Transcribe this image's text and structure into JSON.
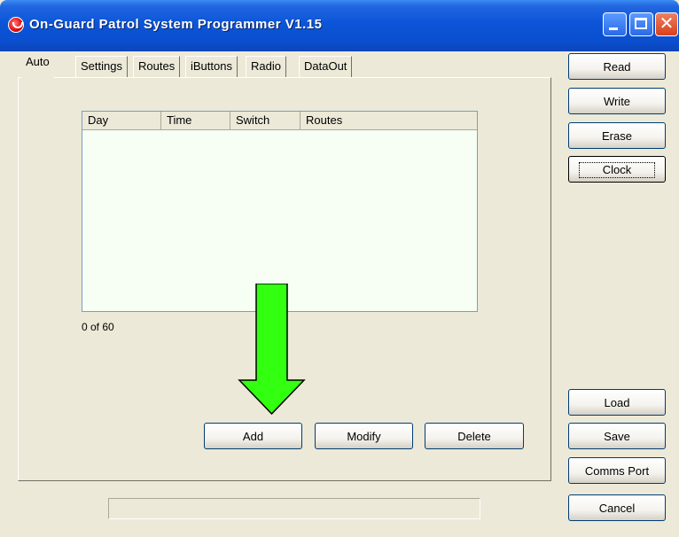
{
  "window": {
    "title": "On-Guard Patrol System Programmer V1.15",
    "close_glyph": "✕"
  },
  "tabs": [
    {
      "label": "Auto",
      "active": true
    },
    {
      "label": "Settings"
    },
    {
      "label": "Routes"
    },
    {
      "label": "iButtons"
    },
    {
      "label": "Radio"
    },
    {
      "label": "DataOut"
    }
  ],
  "schedule_list": {
    "columns": [
      "Day",
      "Time",
      "Switch",
      "Routes"
    ],
    "rows": [],
    "count_text": "0 of 60"
  },
  "list_actions": {
    "add_label": "Add",
    "modify_label": "Modify",
    "delete_label": "Delete"
  },
  "side_buttons": {
    "read": "Read",
    "write": "Write",
    "erase": "Erase",
    "clock": "Clock",
    "load": "Load",
    "save": "Save",
    "comms_port": "Comms Port",
    "cancel": "Cancel"
  },
  "status_bar": {
    "text": ""
  },
  "colors": {
    "titlebar": "#0b55d8",
    "window_bg": "#ece9d8",
    "list_bg": "#f7fff4",
    "annotation_arrow": "#33ff11",
    "close_button": "#d6401c"
  },
  "icons": {
    "app": "on-guard-app-icon",
    "annotation": "down-arrow-icon"
  }
}
